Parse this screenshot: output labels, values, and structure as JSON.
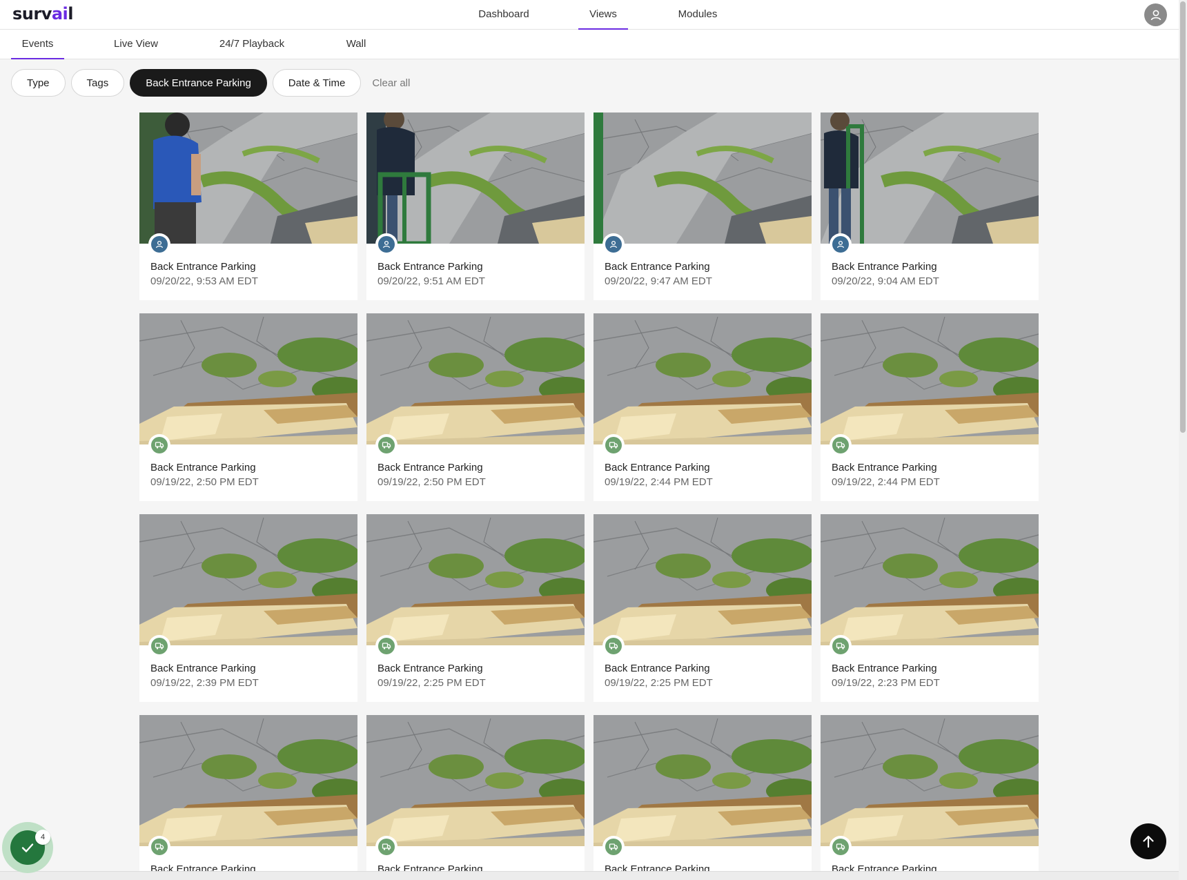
{
  "app": {
    "logo_text": "surv",
    "logo_accent": "ai",
    "logo_tail": "l",
    "accent_color": "#6a2be2"
  },
  "top_nav": {
    "items": [
      {
        "label": "Dashboard",
        "active": false
      },
      {
        "label": "Views",
        "active": true
      },
      {
        "label": "Modules",
        "active": false
      }
    ],
    "user_icon": "user-icon"
  },
  "sub_nav": {
    "tabs": [
      {
        "label": "Events",
        "active": true
      },
      {
        "label": "Live View",
        "active": false
      },
      {
        "label": "24/7 Playback",
        "active": false
      },
      {
        "label": "Wall",
        "active": false
      }
    ]
  },
  "filters": {
    "chips": [
      {
        "label": "Type",
        "active": false
      },
      {
        "label": "Tags",
        "active": false
      },
      {
        "label": "Back Entrance Parking",
        "active": true
      },
      {
        "label": "Date & Time",
        "active": false
      }
    ],
    "clear_label": "Clear all"
  },
  "events": [
    {
      "camera": "Back Entrance Parking",
      "time": "09/20/22, 9:53 AM EDT",
      "type": "person",
      "scene": "person-1"
    },
    {
      "camera": "Back Entrance Parking",
      "time": "09/20/22, 9:51 AM EDT",
      "type": "person",
      "scene": "person-2"
    },
    {
      "camera": "Back Entrance Parking",
      "time": "09/20/22, 9:47 AM EDT",
      "type": "person",
      "scene": "person-3"
    },
    {
      "camera": "Back Entrance Parking",
      "time": "09/20/22, 9:04 AM EDT",
      "type": "person",
      "scene": "person-4"
    },
    {
      "camera": "Back Entrance Parking",
      "time": "09/19/22, 2:50 PM EDT",
      "type": "vehicle",
      "scene": "boxes"
    },
    {
      "camera": "Back Entrance Parking",
      "time": "09/19/22, 2:50 PM EDT",
      "type": "vehicle",
      "scene": "boxes"
    },
    {
      "camera": "Back Entrance Parking",
      "time": "09/19/22, 2:44 PM EDT",
      "type": "vehicle",
      "scene": "boxes"
    },
    {
      "camera": "Back Entrance Parking",
      "time": "09/19/22, 2:44 PM EDT",
      "type": "vehicle",
      "scene": "boxes"
    },
    {
      "camera": "Back Entrance Parking",
      "time": "09/19/22, 2:39 PM EDT",
      "type": "vehicle",
      "scene": "boxes"
    },
    {
      "camera": "Back Entrance Parking",
      "time": "09/19/22, 2:25 PM EDT",
      "type": "vehicle",
      "scene": "boxes"
    },
    {
      "camera": "Back Entrance Parking",
      "time": "09/19/22, 2:25 PM EDT",
      "type": "vehicle",
      "scene": "boxes"
    },
    {
      "camera": "Back Entrance Parking",
      "time": "09/19/22, 2:23 PM EDT",
      "type": "vehicle",
      "scene": "boxes"
    },
    {
      "camera": "Back Entrance Parking",
      "time": "",
      "type": "vehicle",
      "scene": "boxes"
    },
    {
      "camera": "Back Entrance Parking",
      "time": "",
      "type": "vehicle",
      "scene": "boxes"
    },
    {
      "camera": "Back Entrance Parking",
      "time": "",
      "type": "vehicle",
      "scene": "boxes"
    },
    {
      "camera": "Back Entrance Parking",
      "time": "",
      "type": "vehicle",
      "scene": "boxes"
    }
  ],
  "floating": {
    "task_count": "4",
    "task_icon": "check-icon",
    "scroll_top_icon": "arrow-up-icon"
  }
}
